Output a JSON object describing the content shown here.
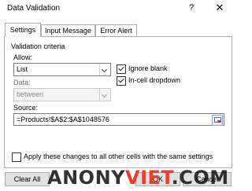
{
  "window": {
    "title": "Data Validation",
    "help_glyph": "?",
    "close_glyph": "✕"
  },
  "tabs": [
    {
      "label": "Settings",
      "active": true
    },
    {
      "label": "Input Message",
      "active": false
    },
    {
      "label": "Error Alert",
      "active": false
    }
  ],
  "settings": {
    "group_title": "Validation criteria",
    "allow_label": "Allow:",
    "allow_value": "List",
    "data_label": "Data:",
    "data_value": "between",
    "ignore_blank_label": "Ignore blank",
    "ignore_blank_checked": true,
    "in_cell_dropdown_label": "In-cell dropdown",
    "in_cell_dropdown_checked": true,
    "source_label": "Source:",
    "source_value": "=Products!$A$2:$A$1048576",
    "apply_all_label": "Apply these changes to all other cells with the same settings",
    "apply_all_checked": false
  },
  "buttons": {
    "clear_all": "Clear All",
    "ok": "OK",
    "cancel": "Cancel"
  },
  "watermark": {
    "part1": "ANONY",
    "part2": "VIET",
    "part3": ".COM"
  }
}
